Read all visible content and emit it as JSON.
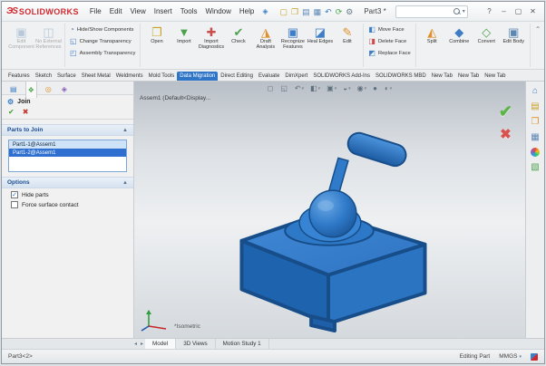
{
  "colors": {
    "brand_red": "#d1282e",
    "accent_blue": "#2e75c8",
    "selection_blue": "#2e6fd0",
    "part_top": "#3a84d2",
    "part_left": "#1e63ad",
    "part_right": "#2a74c2",
    "part_edge": "#174e8a",
    "ok_green": "#5cb544",
    "cancel_red": "#d9534f"
  },
  "titlebar": {
    "brand_icon": "ЭS",
    "brand": "SOLIDWORKS",
    "menus": [
      "File",
      "Edit",
      "View",
      "Insert",
      "Tools",
      "Window",
      "Help"
    ],
    "pin_icon": "◈",
    "quick_tools": [
      {
        "name": "new-document-icon",
        "glyph": "▢",
        "color": "#c9a227"
      },
      {
        "name": "open-icon",
        "glyph": "❐",
        "color": "#c9a227"
      },
      {
        "name": "save-icon",
        "glyph": "▤",
        "color": "#5b87b5"
      },
      {
        "name": "print-icon",
        "glyph": "▦",
        "color": "#5b87b5"
      },
      {
        "name": "undo-icon",
        "glyph": "↶",
        "color": "#3f7ec4"
      },
      {
        "name": "rebuild-icon",
        "glyph": "⟳",
        "color": "#4ea24e"
      },
      {
        "name": "options-gear-icon",
        "glyph": "⚙",
        "color": "#6b7c8c"
      }
    ],
    "doc_title": "Part3 *",
    "search_placeholder": "",
    "search_chevron": "▾",
    "window_controls": [
      {
        "name": "help-button",
        "glyph": "?"
      },
      {
        "name": "minimize-button",
        "glyph": "–"
      },
      {
        "name": "maximize-button",
        "glyph": "▢"
      },
      {
        "name": "close-button",
        "glyph": "✕"
      }
    ]
  },
  "ribbon": {
    "assembly_group": [
      {
        "label": "Edit Component",
        "glyph": "▣",
        "color": "#5b87b5",
        "cls": "disabled"
      },
      {
        "label": "No External References",
        "glyph": "◫",
        "color": "#5b87b5",
        "cls": "disabled"
      }
    ],
    "visibility_stack": [
      {
        "label": "Hide/Show Components",
        "glyph": "◔",
        "color": "#3f7ec4"
      },
      {
        "label": "Change Transparency",
        "glyph": "◱",
        "color": "#3f7ec4"
      },
      {
        "label": "Assembly Transparency",
        "glyph": "◰",
        "color": "#3f7ec4"
      }
    ],
    "import_group": [
      {
        "label": "Open",
        "glyph": "❐",
        "color": "#c9a227"
      },
      {
        "label": "Import",
        "glyph": "▼",
        "color": "#4ea24e"
      },
      {
        "label": "Import Diagnostics",
        "glyph": "✚",
        "color": "#c94f4f"
      },
      {
        "label": "Check",
        "glyph": "✔",
        "color": "#4ea24e"
      },
      {
        "label": "Draft Analysis",
        "glyph": "◮",
        "color": "#e0912f"
      },
      {
        "label": "Recognize Features",
        "glyph": "▣",
        "color": "#3f7ec4"
      },
      {
        "label": "Heal Edges",
        "glyph": "◪",
        "color": "#3f7ec4"
      },
      {
        "label": "Edit",
        "glyph": "✎",
        "color": "#e0912f"
      }
    ],
    "face_stack": [
      {
        "label": "Move Face",
        "glyph": "◧",
        "color": "#3f7ec4"
      },
      {
        "label": "Delete Face",
        "glyph": "◨",
        "color": "#c94f4f"
      },
      {
        "label": "Replace Face",
        "glyph": "◩",
        "color": "#3f7ec4"
      }
    ],
    "body_group": [
      {
        "label": "Split",
        "glyph": "◭",
        "color": "#e0912f"
      },
      {
        "label": "Combine",
        "glyph": "◆",
        "color": "#3f7ec4"
      },
      {
        "label": "Convert",
        "glyph": "◇",
        "color": "#4ea24e"
      },
      {
        "label": "Edit Body",
        "glyph": "▣",
        "color": "#5b87b5"
      }
    ],
    "collapse_icon": "⌃"
  },
  "command_tabs": [
    {
      "label": "Features",
      "cls": ""
    },
    {
      "label": "Sketch",
      "cls": ""
    },
    {
      "label": "Surface",
      "cls": ""
    },
    {
      "label": "Sheet Metal",
      "cls": ""
    },
    {
      "label": "Weldments",
      "cls": ""
    },
    {
      "label": "Mold Tools",
      "cls": ""
    },
    {
      "label": "Data Migration",
      "cls": "active"
    },
    {
      "label": "Direct Editing",
      "cls": ""
    },
    {
      "label": "Evaluate",
      "cls": ""
    },
    {
      "label": "DimXpert",
      "cls": ""
    },
    {
      "label": "SOLIDWORKS Add-Ins",
      "cls": ""
    },
    {
      "label": "SOLIDWORKS MBD",
      "cls": ""
    },
    {
      "label": "New Tab",
      "cls": ""
    },
    {
      "label": "New Tab",
      "cls": ""
    },
    {
      "label": "New Tab",
      "cls": ""
    }
  ],
  "property_panel": {
    "tabs": [
      {
        "name": "featuremanager-tree-tab",
        "glyph": "▤",
        "color": "#3f7ec4",
        "cls": ""
      },
      {
        "name": "propertymanager-tab",
        "glyph": "❖",
        "color": "#4ea24e",
        "cls": "active"
      },
      {
        "name": "configuration-manager-tab",
        "glyph": "◎",
        "color": "#e0912f",
        "cls": ""
      },
      {
        "name": "dimxpert-manager-tab",
        "glyph": "◈",
        "color": "#8b5bb5",
        "cls": ""
      }
    ],
    "feature_icon": "⚙",
    "feature_title": "Join",
    "ok_icon": "✔",
    "cancel_icon": "✖",
    "group_chevron": "▲",
    "parts_group_label": "Parts to Join",
    "parts": [
      {
        "label": "Part1-1@Assem1",
        "cls": "sel-light"
      },
      {
        "label": "Part1-2@Assem1",
        "cls": "sel-dark"
      }
    ],
    "options_group_label": "Options",
    "options": [
      {
        "label": "Hide parts",
        "cls": "checked"
      },
      {
        "label": "Force surface contact",
        "cls": ""
      }
    ]
  },
  "viewport": {
    "model_label": "Assem1 (Default<Display...",
    "headsup": [
      {
        "name": "zoom-fit-icon",
        "glyph": "◻",
        "chev": ""
      },
      {
        "name": "zoom-area-icon",
        "glyph": "◱",
        "chev": ""
      },
      {
        "name": "previous-view-icon",
        "glyph": "↶",
        "chev": "▾"
      },
      {
        "name": "section-view-icon",
        "glyph": "◧",
        "chev": "▾"
      },
      {
        "name": "view-orientation-icon",
        "glyph": "▣",
        "chev": "▾"
      },
      {
        "name": "display-style-icon",
        "glyph": "◒",
        "chev": "▾"
      },
      {
        "name": "hide-show-items-icon",
        "glyph": "◉",
        "chev": "▾"
      },
      {
        "name": "edit-appearance-icon",
        "glyph": "●",
        "chev": ""
      },
      {
        "name": "view-settings-icon",
        "glyph": "◐",
        "chev": "▾"
      }
    ],
    "confirm_icon": "✔",
    "cancel_icon": "✖",
    "orientation_label": "*Isometric"
  },
  "task_pane": [
    {
      "name": "resources-home-icon",
      "glyph": "⌂",
      "color": "#3f7ec4",
      "cls": ""
    },
    {
      "name": "design-library-icon",
      "glyph": "▤",
      "color": "#c9a227",
      "cls": ""
    },
    {
      "name": "file-explorer-icon",
      "glyph": "❐",
      "color": "#e0912f",
      "cls": ""
    },
    {
      "name": "view-palette-icon",
      "glyph": "▦",
      "color": "#5b87b5",
      "cls": ""
    },
    {
      "name": "appearances-icon",
      "glyph": "●",
      "color": "",
      "cls": "ball"
    },
    {
      "name": "custom-properties-icon",
      "glyph": "▧",
      "color": "#4ea24e",
      "cls": ""
    }
  ],
  "bottom_tabs": {
    "nav_left_icon": "◂",
    "nav_right_icon": "▸",
    "tabs": [
      {
        "label": "Model",
        "cls": "active"
      },
      {
        "label": "3D Views",
        "cls": ""
      },
      {
        "label": "Motion Study 1",
        "cls": ""
      }
    ]
  },
  "statusbar": {
    "left": "Part3<2>",
    "editing": "Editing Part",
    "units": "MMGS",
    "units_chevron": "▾"
  }
}
